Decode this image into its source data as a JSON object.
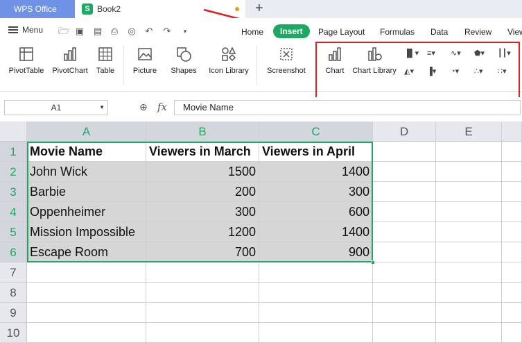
{
  "titlebar": {
    "app_tab": "WPS Office",
    "doc_tab": "Book2",
    "new_tab": "+"
  },
  "menu": {
    "menu_label": "Menu"
  },
  "ribbon_tabs": [
    "Home",
    "Insert",
    "Page Layout",
    "Formulas",
    "Data",
    "Review",
    "View"
  ],
  "active_tab": "Insert",
  "ribbon": {
    "pivottable": "PivotTable",
    "pivotchart": "PivotChart",
    "table": "Table",
    "picture": "Picture",
    "shapes": "Shapes",
    "icon_library": "Icon Library",
    "screenshot": "Screenshot",
    "chart": "Chart",
    "chart_library": "Chart Library"
  },
  "formula_bar": {
    "name_box": "A1",
    "fx": "fx",
    "content": "Movie Name"
  },
  "columns": [
    "A",
    "B",
    "C",
    "D",
    "E"
  ],
  "rows": [
    "1",
    "2",
    "3",
    "4",
    "5",
    "6",
    "7",
    "8",
    "9",
    "10"
  ],
  "sheet": {
    "headers": [
      "Movie Name",
      "Viewers in March",
      "Viewers in April"
    ],
    "data": [
      [
        "John Wick",
        "1500",
        "1400"
      ],
      [
        "Barbie",
        "200",
        "300"
      ],
      [
        "Oppenheimer",
        "300",
        "600"
      ],
      [
        "Mission Impossible",
        "1200",
        "1400"
      ],
      [
        "Escape Room",
        "700",
        "900"
      ]
    ]
  },
  "colors": {
    "accent": "#1ea963",
    "highlight": "#e02020",
    "app_tab": "#6f91e6"
  }
}
